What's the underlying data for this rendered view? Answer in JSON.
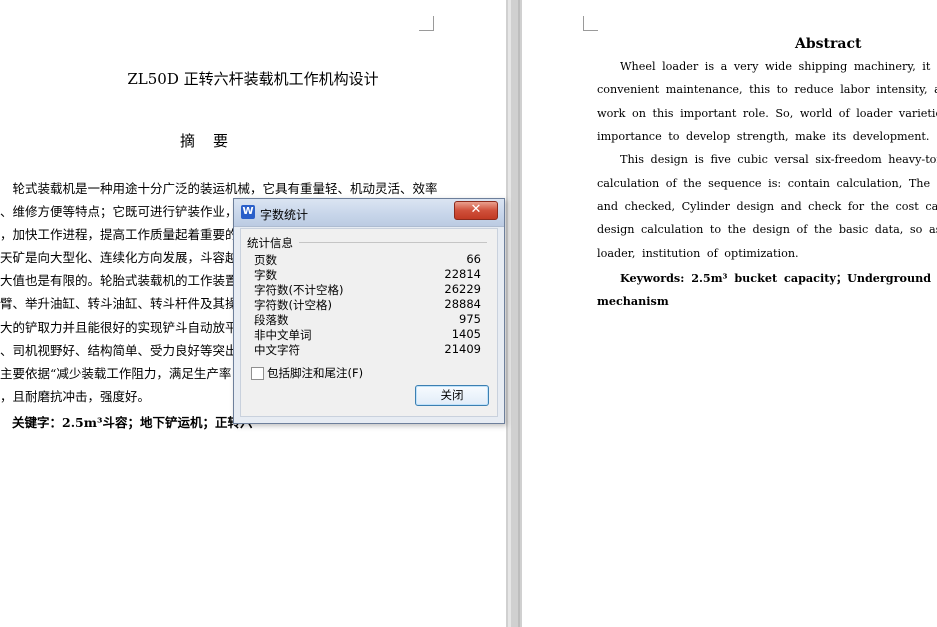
{
  "left_page": {
    "title": "ZL50D 正转六杆装载机工作机构设计",
    "heading": "摘　要",
    "lines": [
      "　轮式装载机是一种用途十分广泛的装运机械，它具有重量轻、机动灵活、效率",
      "、维修方便等特点；它既可进行铲装作业，",
      "，加快工作进程，提高工作质量起着重要的",
      "天矿是向大型化、连续化方向发展，斗容越",
      "大值也是有限的。轮胎式装载机的工作装置",
      "臂、举升油缸、转斗油缸、转斗杆件及其操",
      "大的铲取力并且能很好的实现铲斗自动放平",
      "、司机视野好、结构简单、受力良好等突出",
      "主要依据“减少装载工作阻力，满足生产率",
      "，且耐磨抗冲击，强度好。"
    ],
    "keywords_line": "关键字：2.5m³斗容；地下铲运机；正转六"
  },
  "right_page": {
    "abstract_title": "Abstract",
    "lines": [
      "Wheel  loader  is  a  very  wide  shipping  machinery,  it  is  light,",
      "convenient  maintenance,  this  to  reduce  labor  intensity,  accelerated,",
      "work  on  this  important  role.  So,  world  of  loader  varieties,  producti",
      "importance to develop strength, make its development.",
      "This  design  is  five  cubic  versal  six-freedom  heavy-tonnage  l",
      "calculation  of  the  sequence  is:  contain  calculation,  The  design  of  buc",
      "and  checked,  Cylinder  design  and  check  for  the  cost  calculation.  T",
      "design calculation to the design of the basic data, so as to realize the o",
      "loader, institution of optimization.",
      "Keywords: 2.5m³ bucket capacity；Underground differentials",
      "mechanism"
    ]
  },
  "dialog": {
    "title": "字数统计",
    "close_x": "✕",
    "group_label": "统计信息",
    "stats": [
      {
        "label": "页数",
        "value": "66"
      },
      {
        "label": "字数",
        "value": "22814"
      },
      {
        "label": "字符数(不计空格)",
        "value": "26229"
      },
      {
        "label": "字符数(计空格)",
        "value": "28884"
      },
      {
        "label": "段落数",
        "value": "975"
      },
      {
        "label": "非中文单词",
        "value": "1405"
      },
      {
        "label": "中文字符",
        "value": "21409"
      }
    ],
    "checkbox_label": "包括脚注和尾注(F)",
    "checkbox_checked": false,
    "close_button": "关闭"
  }
}
